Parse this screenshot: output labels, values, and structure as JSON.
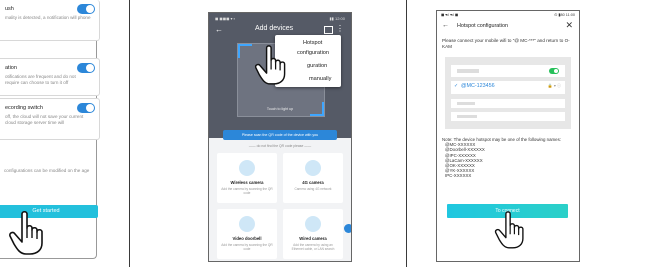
{
  "left_panel": {
    "items": [
      {
        "title": "ush",
        "desc": "mality is detected, a notification will phone"
      },
      {
        "title": "ation",
        "desc": "otifications are frequent and do not require can choose to turn it off"
      },
      {
        "title": "ecording switch",
        "desc": "off, the cloud will not save your current cloud storage server time will"
      }
    ],
    "note": "configurations can be modified on the age",
    "button": "Get started"
  },
  "middle_phone": {
    "status_left": "◼ ◼◼◼ ▾ ▪",
    "status_right": "▮▮ 12:00",
    "back": "←",
    "title": "Add devices",
    "more": "⋮",
    "menu": [
      "Hotspot",
      "configuration",
      "guration",
      "manually"
    ],
    "torch": "Touch to light up",
    "tip": "Please scan the QR code of the device with you",
    "cant_find": "—— do not find the QR code please ——",
    "tiles": [
      {
        "title": "Wireless camera",
        "sub": "Add the camera by scanning the QR code"
      },
      {
        "title": "4G camera",
        "sub": "Camera using 4G network"
      },
      {
        "title": "Video doorbell",
        "sub": "Add the camera by scanning the QR code"
      },
      {
        "title": "Wired camera",
        "sub": "Add the camera by using an Ethernet cable, or LAN search"
      }
    ]
  },
  "right_phone": {
    "status_left": "◼ ▾ıl ▾ıl ◼",
    "status_right": "⊙ ▮80 11:00",
    "back": "←",
    "title": "Hotspot configuration",
    "close": "✕",
    "instruction": "Please connect your mobile wifi to \"@ MC-***\" and return to O-KAM",
    "ssid": "@MC-123456",
    "check": "✓",
    "ssid_icons": "🔒 ▾ ⓘ",
    "notes": [
      "Note: The device hotspot may be one of the following names:",
      "@MC-XXXXXX",
      "@Doorbell-XXXXXX",
      "@IPC-XXXXXX",
      "@LaCam-XXXXXX",
      "@OK-XXXXXX",
      "@YK-XXXXXX",
      "IPC-XXXXXX"
    ],
    "connect_button": "To connect"
  },
  "colors": {
    "accent": "#2c87d9",
    "cyan": "#23c0dc",
    "green": "#27c05a"
  }
}
